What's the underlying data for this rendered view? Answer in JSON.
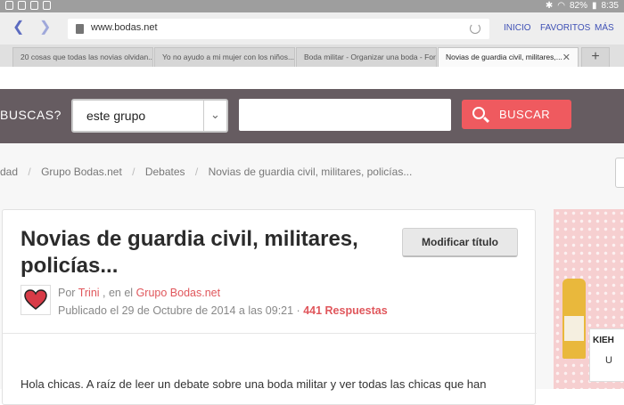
{
  "statusbar": {
    "battery": "82%",
    "time": "8:35"
  },
  "browser": {
    "url": "www.bodas.net",
    "nav": [
      "INICIO",
      "FAVORITOS",
      "MÁS"
    ],
    "tabs": [
      "20 cosas que todas las novias olvidan...",
      "Yo no ayudo a mi mujer con los niños...",
      "Boda militar - Organizar una boda - For...",
      "Novias de guardia civil, militares,..."
    ],
    "tab_plus": "+"
  },
  "search": {
    "label": "BUSCAS?",
    "scope_value": "este grupo",
    "query_value": "",
    "button_label": "BUSCAR"
  },
  "breadcrumb": {
    "items": [
      "dad",
      "Grupo Bodas.net",
      "Debates",
      "Novias de guardia civil, militares, policías..."
    ]
  },
  "post": {
    "title": "Novias de guardia civil, militares, policías...",
    "edit_button": "Modificar título",
    "by_label": "Por",
    "author": "Trini",
    "in_label": ", en el",
    "group": "Grupo Bodas.net",
    "published": "Publicado el 29 de Octubre de 2014 a las 09:21 ·",
    "replies": "441 Respuestas",
    "body_start": "Hola chicas. A raíz de leer un debate sobre una boda militar y ver todas las chicas que han"
  },
  "ad": {
    "text1": "KIEH",
    "text2": "U"
  },
  "colors": {
    "accent": "#ef5a5f",
    "search_bg": "#665c61",
    "browser_blue": "#3f51b5"
  }
}
